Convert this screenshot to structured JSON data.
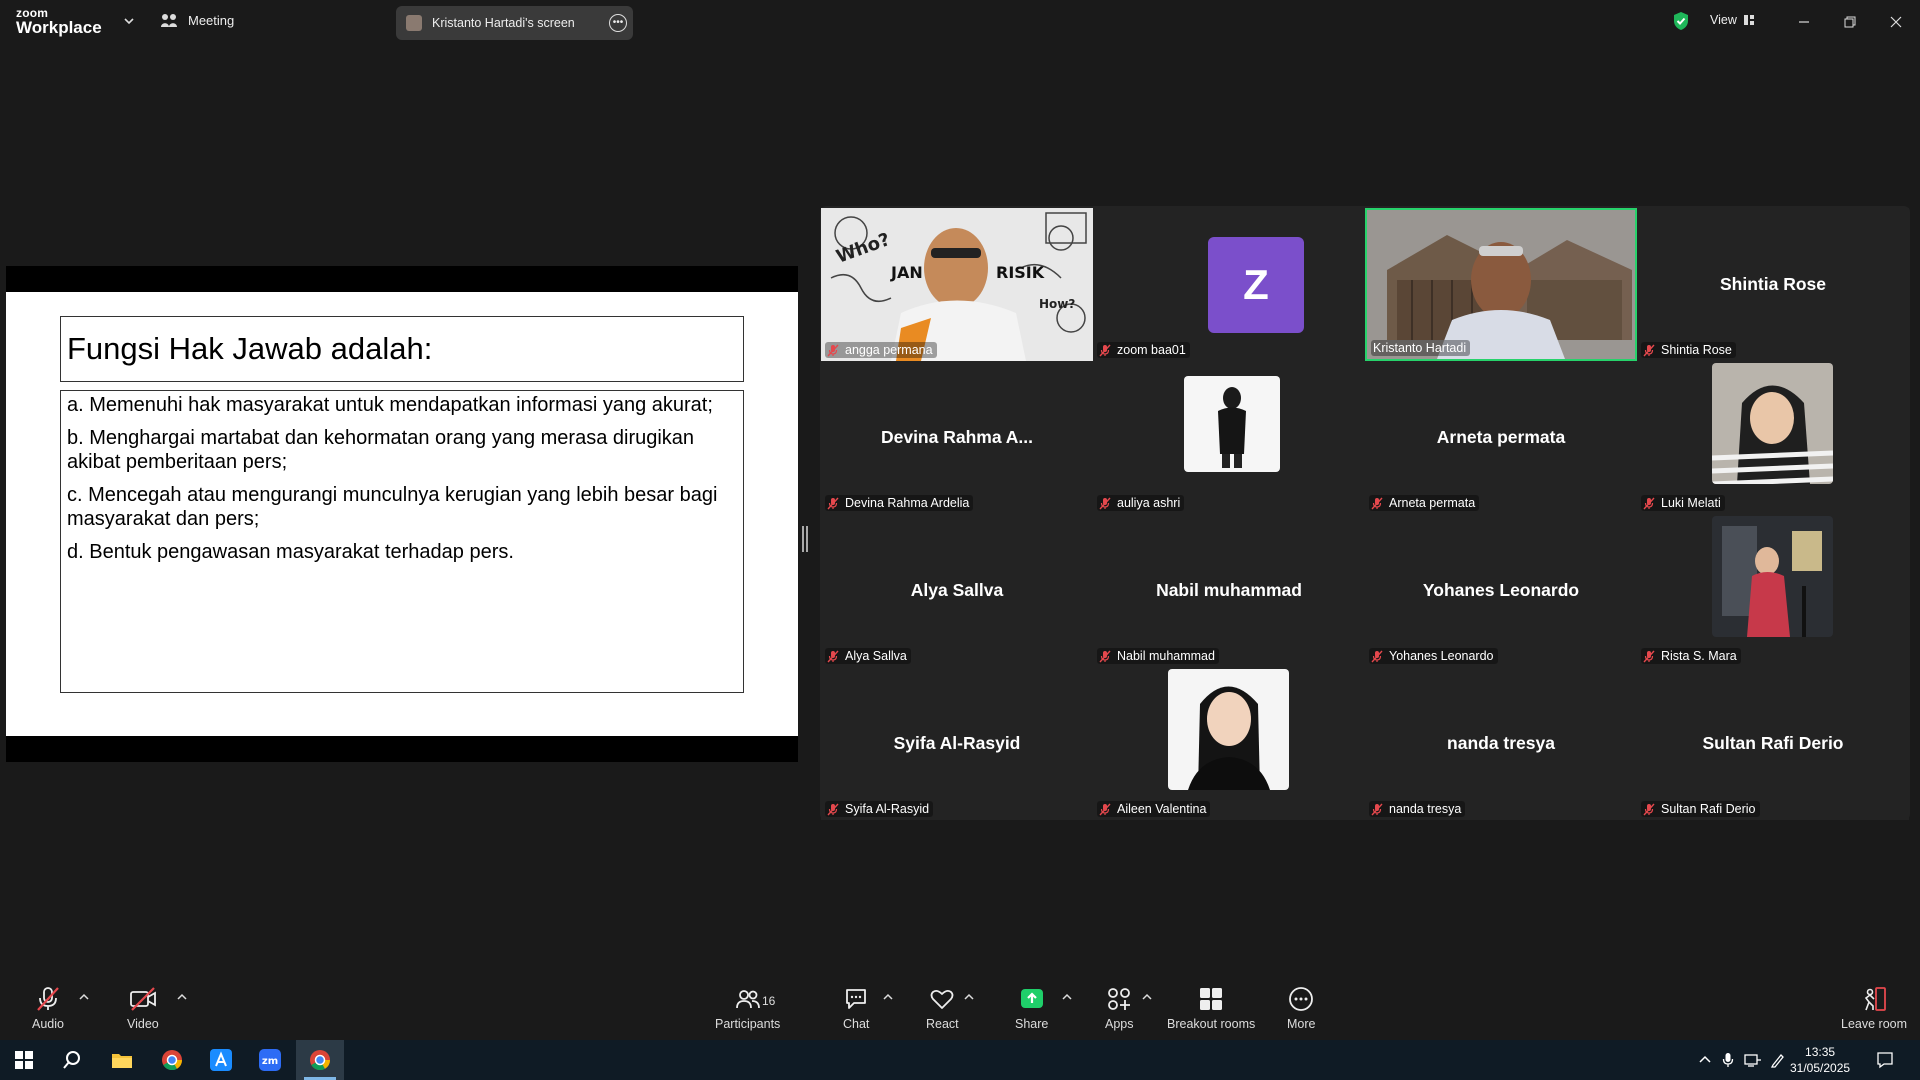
{
  "app": {
    "logo_top": "zoom",
    "logo_bottom": "Workplace",
    "meeting_label": "Meeting",
    "screen_label": "Kristanto Hartadi's screen",
    "view_label": "View"
  },
  "slide": {
    "title": "Fungsi Hak Jawab adalah:",
    "items": [
      "a. Memenuhi hak masyarakat untuk mendapatkan informasi yang akurat;",
      "b. Menghargai martabat dan kehormatan orang yang merasa dirugikan akibat pemberitaan pers;",
      "c. Mencegah atau mengurangi  munculnya kerugian yang lebih besar bagi masyarakat dan pers;",
      "d. Bentuk pengawasan masyarakat terhadap pers."
    ]
  },
  "participants": [
    {
      "name": "angga permana",
      "display": "",
      "kind": "video"
    },
    {
      "name": "zoom baa01",
      "display": "Z",
      "kind": "avatar-letter"
    },
    {
      "name": "Kristanto Hartadi",
      "display": "",
      "kind": "video-active"
    },
    {
      "name": "Shintia Rose",
      "display": "Shintia Rose",
      "kind": "name"
    },
    {
      "name": "Devina Rahma Ardelia",
      "display": "Devina  Rahma  A...",
      "kind": "name"
    },
    {
      "name": "auliya ashri",
      "display": "",
      "kind": "photo"
    },
    {
      "name": "Arneta permata",
      "display": "Arneta permata",
      "kind": "name"
    },
    {
      "name": "Luki Melati",
      "display": "",
      "kind": "photo"
    },
    {
      "name": "Alya Sallva",
      "display": "Alya Sallva",
      "kind": "name"
    },
    {
      "name": "Nabil muhammad",
      "display": "Nabil muhammad",
      "kind": "name"
    },
    {
      "name": "Yohanes Leonardo",
      "display": "Yohanes Leonardo",
      "kind": "name"
    },
    {
      "name": "Rista S. Mara",
      "display": "",
      "kind": "photo"
    },
    {
      "name": "Syifa Al-Rasyid",
      "display": "Syifa Al-Rasyid",
      "kind": "name"
    },
    {
      "name": "Aileen Valentina",
      "display": "",
      "kind": "photo"
    },
    {
      "name": "nanda tresya",
      "display": "nanda tresya",
      "kind": "name"
    },
    {
      "name": "Sultan Rafi Derio",
      "display": "Sultan Rafi Derio",
      "kind": "name"
    }
  ],
  "toolbar": {
    "audio": "Audio",
    "video": "Video",
    "participants": "Participants",
    "participants_count": "16",
    "chat": "Chat",
    "react": "React",
    "share": "Share",
    "apps": "Apps",
    "breakout": "Breakout rooms",
    "more": "More",
    "leave": "Leave room"
  },
  "taskbar": {
    "time": "13:35",
    "date": "31/05/2025"
  },
  "colors": {
    "active_speaker": "#27d26b",
    "share_green": "#1fcf6a",
    "avatar_purple": "#7b4fcb",
    "mute_red": "#e5484d"
  }
}
